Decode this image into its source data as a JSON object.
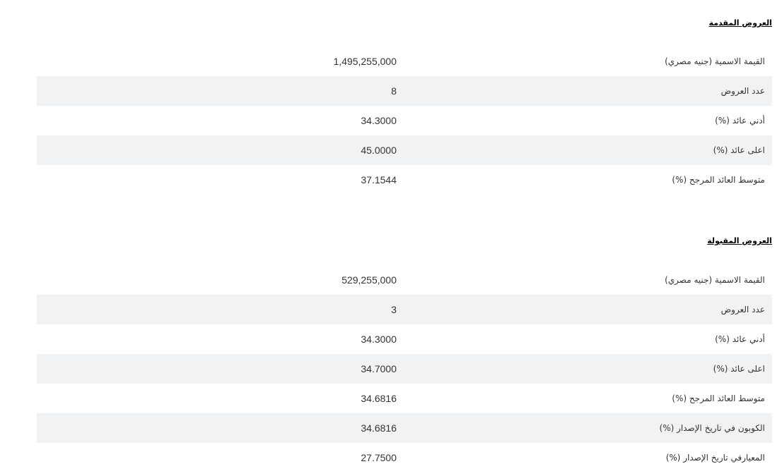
{
  "offered": {
    "title": "العروض المقدمة",
    "rows": [
      {
        "label": "القيمة الاسمية (جنيه مصري)",
        "value": "1,495,255,000"
      },
      {
        "label": "عدد العروض",
        "value": "8"
      },
      {
        "label": "أدني عائد (%)",
        "value": "34.3000"
      },
      {
        "label": "اعلى عائد (%)",
        "value": "45.0000"
      },
      {
        "label": "متوسط العائد المرجح (%)",
        "value": "37.1544"
      }
    ]
  },
  "accepted": {
    "title": "العروض المقبولة",
    "rows": [
      {
        "label": "القيمة الاسمية (جنيه مصري)",
        "value": "529,255,000"
      },
      {
        "label": "عدد العروض",
        "value": "3"
      },
      {
        "label": "أدني عائد (%)",
        "value": "34.3000"
      },
      {
        "label": "اعلى عائد (%)",
        "value": "34.7000"
      },
      {
        "label": "متوسط العائد المرجح (%)",
        "value": "34.6816"
      },
      {
        "label": "الكوبون في تاريخ الإصدار (%)",
        "value": "34.6816"
      },
      {
        "label": "المعيارفي تاريخ الإصدار (%)",
        "value": "27.7500"
      }
    ]
  }
}
